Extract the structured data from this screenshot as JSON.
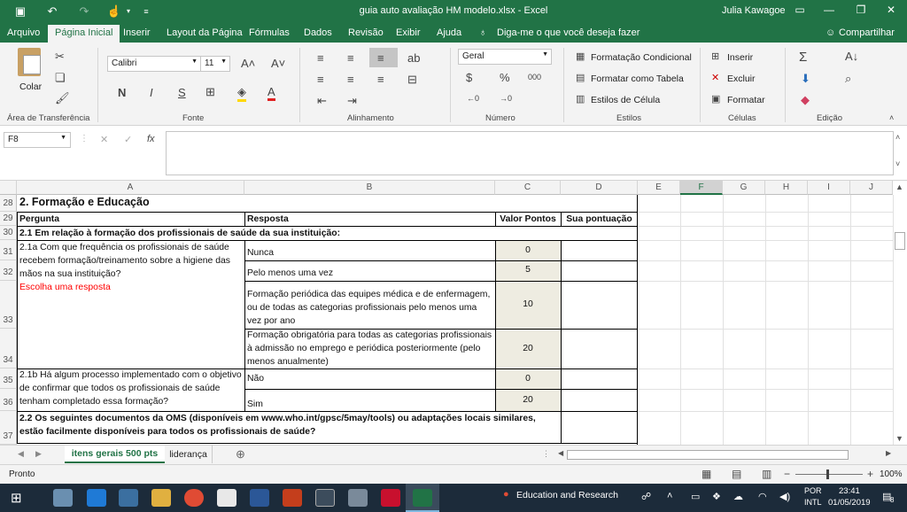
{
  "titlebar": {
    "filename": "guia auto avaliação HM modelo.xlsx  -  Excel",
    "user": "Julia Kawagoe"
  },
  "menu_tabs": [
    "Arquivo",
    "Página Inicial",
    "Inserir",
    "Layout da Página",
    "Fórmulas",
    "Dados",
    "Revisão",
    "Exibir",
    "Ajuda"
  ],
  "tell_me": "Diga-me o que você deseja fazer",
  "share": "Compartilhar",
  "ribbon": {
    "paste": "Colar",
    "font_name": "Calibri",
    "font_size": "11",
    "bold": "N",
    "italic": "I",
    "underline": "S",
    "number_format": "Geral",
    "cond_format": "Formatação Condicional",
    "format_table": "Formatar como Tabela",
    "cell_styles": "Estilos de Célula",
    "insert": "Inserir",
    "delete": "Excluir",
    "format": "Formatar",
    "percent": "%",
    "thousands": "000",
    "groups": [
      "Área de Transferência",
      "Fonte",
      "Alinhamento",
      "Número",
      "Estilos",
      "Células",
      "Edição"
    ]
  },
  "namebox": "F8",
  "fx": "fx",
  "columns": [
    "A",
    "B",
    "C",
    "D",
    "E",
    "F",
    "G",
    "H",
    "I",
    "J"
  ],
  "rows": [
    "28",
    "29",
    "30",
    "31",
    "32",
    "33",
    "34",
    "35",
    "36",
    "37"
  ],
  "sheet": {
    "r28": "2. Formação e Educação",
    "h_pergunta": "Pergunta",
    "h_resposta": "Resposta",
    "h_valor": "Valor Pontos",
    "h_pont": "Sua pontuação",
    "r30": "2.1 Em relação à formação dos profissionais de saúde da sua instituição:",
    "q21a": "2.1a Com que frequência os profissionais de saúde recebem formação/treinamento sobre a higiene das mãos na sua instituição?",
    "escolha": "Escolha uma resposta",
    "a_nunca": "Nunca",
    "v_nunca": "0",
    "a_pelo": "Pelo menos uma vez",
    "v_pelo": "5",
    "a_period": "Formação periódica das equipes médica e de enfermagem, ou de todas as categorias profissionais pelo menos uma vez por ano",
    "v_period": "10",
    "a_obrig": "Formação obrigatória para todas as categorias profissionais à admissão no emprego e periódica posteriormente (pelo menos anualmente)",
    "v_obrig": "20",
    "q21b": "2.1b Há algum processo implementado com o objetivo de confirmar que todos os profissionais de saúde tenham completado essa formação?",
    "a_nao": "Não",
    "v_nao": "0",
    "a_sim": "Sim",
    "v_sim": "20",
    "r37": "2.2 Os seguintes documentos da OMS (disponíveis em www.who.int/gpsc/5may/tools) ou adaptações locais similares, estão facilmente disponíveis para todos os profissionais de saúde?"
  },
  "sheet_tabs": [
    "itens gerais 500 pts",
    "liderança"
  ],
  "status": "Pronto",
  "zoom": "100%",
  "taskbar": {
    "search_app": "Education and Research",
    "lang1": "POR",
    "lang2": "INTL",
    "time": "23:41",
    "date": "01/05/2019",
    "notif": "8"
  },
  "colors": {
    "excel_green": "#217346",
    "value_fill": "#eeece1",
    "red_text": "#ff0000"
  }
}
